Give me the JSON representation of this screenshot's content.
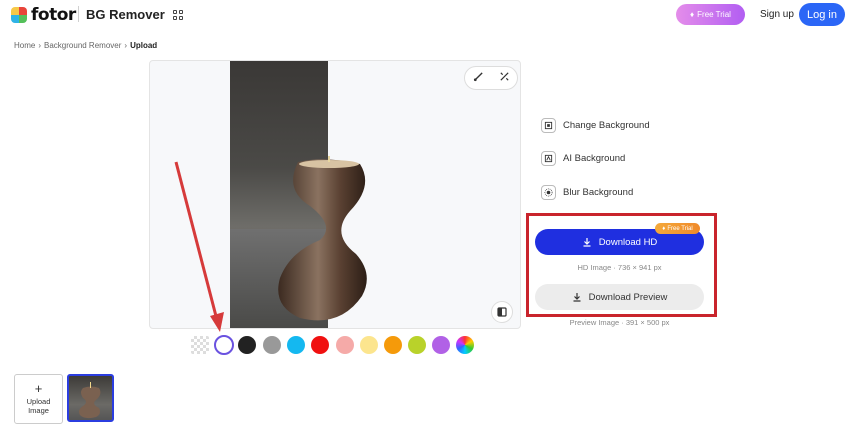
{
  "header": {
    "logo_text": "fotor",
    "product": "BG Remover",
    "free_trial": "Free Trial",
    "signup": "Sign up",
    "login": "Log in"
  },
  "breadcrumb": {
    "items": [
      "Home",
      "Background Remover",
      "Upload"
    ]
  },
  "canvas": {
    "tools": [
      "brush-icon",
      "magic-eraser-icon"
    ],
    "compare_icon": "compare-icon"
  },
  "swatches": {
    "colors": [
      "transparent",
      "#ffffff",
      "#222222",
      "#999999",
      "#14b8f0",
      "#f01010",
      "#f5aaa8",
      "#fce58e",
      "#f59a0a",
      "#b9d22a",
      "#b161e6",
      "rainbow"
    ],
    "selected": "#ffffff"
  },
  "side_panel": {
    "options": [
      "Change Background",
      "AI Background",
      "Blur Background"
    ],
    "download_hd": "Download HD",
    "free_trial_badge": "Free Trial",
    "hd_info": "HD Image · 736 × 941 px",
    "download_preview": "Download Preview",
    "preview_info": "Preview Image · 391 × 500 px"
  },
  "bottom": {
    "upload_label_1": "Upload",
    "upload_label_2": "Image"
  },
  "colors": {
    "primary": "#2b66f6",
    "download_hd": "#1f2fe0",
    "highlight": "#c9242c",
    "arrow": "#d63a3a"
  }
}
